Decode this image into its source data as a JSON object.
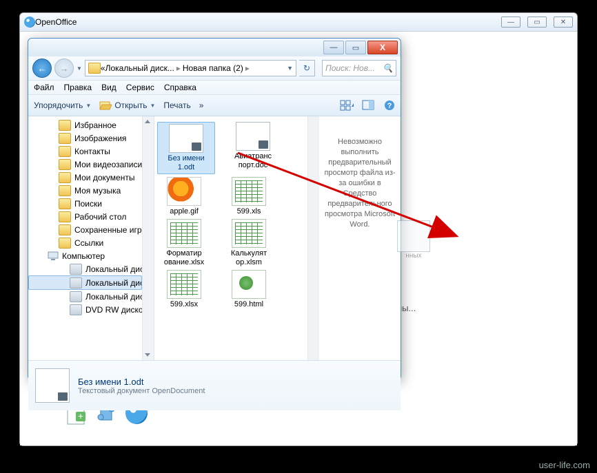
{
  "bg": {
    "title": "OpenOffice",
    "hint": "ны...",
    "ghost_label": "нных"
  },
  "explorer": {
    "crumbs": {
      "pre": "«",
      "disk": "Локальный диск...",
      "folder": "Новая папка (2)",
      "tail": ""
    },
    "search_placeholder": "Поиск: Нов...",
    "menu": {
      "file": "Файл",
      "edit": "Правка",
      "view": "Вид",
      "service": "Сервис",
      "help": "Справка"
    },
    "toolbar": {
      "organize": "Упорядочить",
      "open": "Открыть",
      "print": "Печать",
      "more": "»"
    },
    "tree": {
      "items": [
        {
          "label": "Избранное",
          "icon": "folder"
        },
        {
          "label": "Изображения",
          "icon": "folder"
        },
        {
          "label": "Контакты",
          "icon": "folder"
        },
        {
          "label": "Мои видеозаписи",
          "icon": "folder"
        },
        {
          "label": "Мои документы",
          "icon": "folder"
        },
        {
          "label": "Моя музыка",
          "icon": "folder"
        },
        {
          "label": "Поиски",
          "icon": "folder"
        },
        {
          "label": "Рабочий стол",
          "icon": "folder"
        },
        {
          "label": "Сохраненные игры",
          "icon": "folder"
        },
        {
          "label": "Ссылки",
          "icon": "folder"
        }
      ],
      "computer": "Компьютер",
      "drives": [
        {
          "label": "Локальный диск (C:)"
        },
        {
          "label": "Локальный диск (D:)",
          "selected": true
        },
        {
          "label": "Локальный диск (E:)"
        },
        {
          "label": "DVD RW дисковод (F:"
        }
      ]
    },
    "files": [
      {
        "label": "Без имени 1.odt",
        "type": "doc",
        "selected": true
      },
      {
        "label": "Авиатранс порт.doc",
        "type": "doc"
      },
      {
        "label": "apple.gif",
        "type": "gif"
      },
      {
        "label": "599.xls",
        "type": "xls"
      },
      {
        "label": "Форматир ование.xlsx",
        "type": "xls"
      },
      {
        "label": "Калькулят ор.xlsm",
        "type": "xls"
      },
      {
        "label": "599.xlsx",
        "type": "xls"
      },
      {
        "label": "599.html",
        "type": "html"
      }
    ],
    "preview": "Невозможно выполнить предварительный просмотр файла из-за ошибки в Средство предварительного просмотра Microsoft Word.",
    "details": {
      "name": "Без имени 1.odt",
      "type": "Текстовый документ OpenDocument"
    }
  },
  "watermark": "user-life.com"
}
